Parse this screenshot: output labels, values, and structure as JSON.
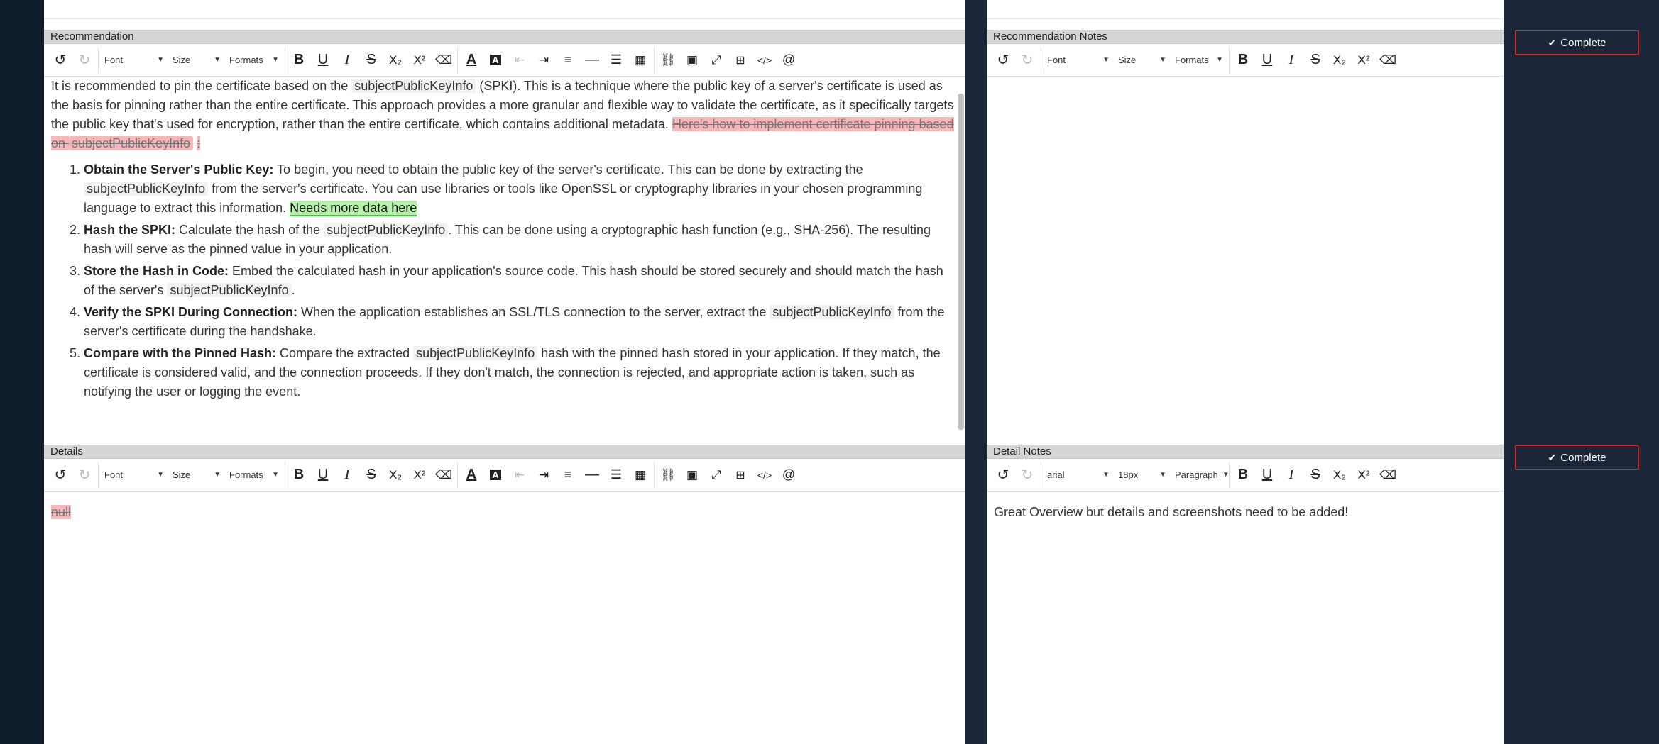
{
  "toolbar_default": {
    "font": "Font",
    "size": "Size",
    "formats": "Formats"
  },
  "toolbar_detail_notes": {
    "font": "arial",
    "size": "18px",
    "formats": "Paragraph"
  },
  "recommendation": {
    "header": "Recommendation",
    "intro_1": "It is recommended to pin the certificate based on the ",
    "code": "subjectPublicKeyInfo",
    "intro_2": " (SPKI). This is a technique where the public key of a server's certificate is used as the basis for pinning rather than the entire certificate. This approach provides a more granular and flexible way to validate the certificate, as it specifically targets the public key that's used for encryption, rather than the entire certificate, which contains additional metadata. ",
    "deleted_1": "Here's how to implement certificate pinning based on ",
    "deleted_2": ":",
    "steps": [
      {
        "title": "Obtain the Server's Public Key:",
        "text_1": " To begin, you need to obtain the public key of the server's certificate. This can be done by extracting the ",
        "text_2": " from the server's certificate. You can use libraries or tools like OpenSSL or cryptography libraries in your chosen programming language to extract this information. ",
        "inserted": "Needs more data here"
      },
      {
        "title": "Hash the SPKI:",
        "text_1": " Calculate the hash of the ",
        "text_2": ". This can be done using a cryptographic hash function (e.g., SHA-256). The resulting hash will serve as the pinned value in your application."
      },
      {
        "title": "Store the Hash in Code:",
        "text_1": " Embed the calculated hash in your application's source code. This hash should be stored securely and should match the hash of the server's ",
        "text_2": "."
      },
      {
        "title": "Verify the SPKI During Connection:",
        "text_1": " When the application establishes an SSL/TLS connection to the server, extract the ",
        "text_2": " from the server's certificate during the handshake."
      },
      {
        "title": "Compare with the Pinned Hash:",
        "text_1": " Compare the extracted ",
        "text_2": " hash with the pinned hash stored in your application. If they match, the certificate is considered valid, and the connection proceeds. If they don't match, the connection is rejected, and appropriate action is taken, such as notifying the user or logging the event."
      }
    ]
  },
  "details": {
    "header": "Details",
    "content": "null"
  },
  "recommendation_notes": {
    "header": "Recommendation Notes"
  },
  "detail_notes": {
    "header": "Detail Notes",
    "content": "Great Overview but details and screenshots need to be added!"
  },
  "actions": {
    "complete_label": "Complete"
  },
  "colors": {
    "page_bg": "#0d1b2a",
    "panel_bg": "#ffffff",
    "deleted_highlight": "#f6b7bb",
    "inserted_highlight": "#b4f0a8",
    "button_border": "#c9302c"
  }
}
